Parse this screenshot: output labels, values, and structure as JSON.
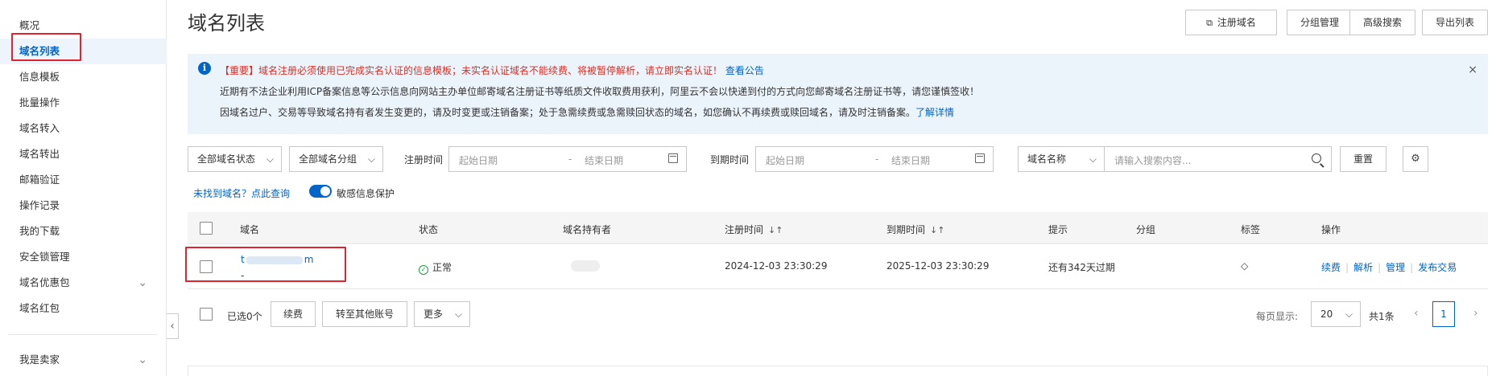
{
  "sidebar": {
    "items": [
      {
        "label": "概况"
      },
      {
        "label": "域名列表"
      },
      {
        "label": "信息模板"
      },
      {
        "label": "批量操作"
      },
      {
        "label": "域名转入"
      },
      {
        "label": "域名转出"
      },
      {
        "label": "邮箱验证"
      },
      {
        "label": "操作记录"
      },
      {
        "label": "我的下载"
      },
      {
        "label": "安全锁管理"
      },
      {
        "label": "域名优惠包"
      },
      {
        "label": "域名红包"
      }
    ],
    "seller": "我是卖家",
    "collapse_glyph": "‹",
    "chevron_glyph": "⌄"
  },
  "header": {
    "title": "域名列表",
    "buttons": {
      "register": "注册域名",
      "group": "分组管理",
      "advanced": "高级搜索",
      "export": "导出列表"
    },
    "external_glyph": "⧉"
  },
  "notice": {
    "icon": "i",
    "line1": "【重要】域名注册必须使用已完成实名认证的信息模板；未实名认证域名不能续费、将被暂停解析，请立即实名认证！",
    "line1_link": "查看公告",
    "line2": "近期有不法企业利用ICP备案信息等公示信息向网站主办单位邮寄域名注册证书等纸质文件收取费用获利，阿里云不会以快递到付的方式向您邮寄域名注册证书等，请您谨慎签收！",
    "line3": "因域名过户、交易等导致域名持有者发生变更的，请及时变更或注销备案；处于急需续费或急需赎回状态的域名，如您确认不再续费或赎回域名，请及时注销备案。",
    "line3_link": "了解详情",
    "close": "×"
  },
  "filters": {
    "status": "全部域名状态",
    "group": "全部域名分组",
    "reg_label": "注册时间",
    "exp_label": "到期时间",
    "start_ph": "起始日期",
    "end_ph": "结束日期",
    "dash": "-",
    "search_field": "域名名称",
    "search_ph": "请输入搜索内容...",
    "reset": "重置",
    "settings_glyph": "⚙",
    "chevron": "⌵"
  },
  "links": {
    "not_found": "未找到域名？点此查询",
    "sensitive": "敏感信息保护"
  },
  "table": {
    "headers": {
      "domain": "域名",
      "status": "状态",
      "holder": "域名持有者",
      "reg_time": "注册时间",
      "exp_time": "到期时间",
      "hint": "提示",
      "group": "分组",
      "tag": "标签",
      "ops": "操作"
    },
    "sort_glyph": "↓↑",
    "rows": [
      {
        "domain_prefix": "t",
        "domain_suffix": "m",
        "domain_sub": "-",
        "status": "正常",
        "reg_time": "2024-12-03 23:30:29",
        "exp_time": "2025-12-03 23:30:29",
        "hint": "还有342天过期",
        "tag_glyph": "◇",
        "ops": [
          "续费",
          "解析",
          "管理",
          "发布交易"
        ]
      }
    ]
  },
  "footer": {
    "selected": "已选0个",
    "renew": "续费",
    "transfer": "转至其他账号",
    "more": "更多",
    "per_page_label": "每页显示:",
    "per_page": "20",
    "total": "共1条",
    "prev": "‹",
    "next": "›",
    "page": "1"
  }
}
